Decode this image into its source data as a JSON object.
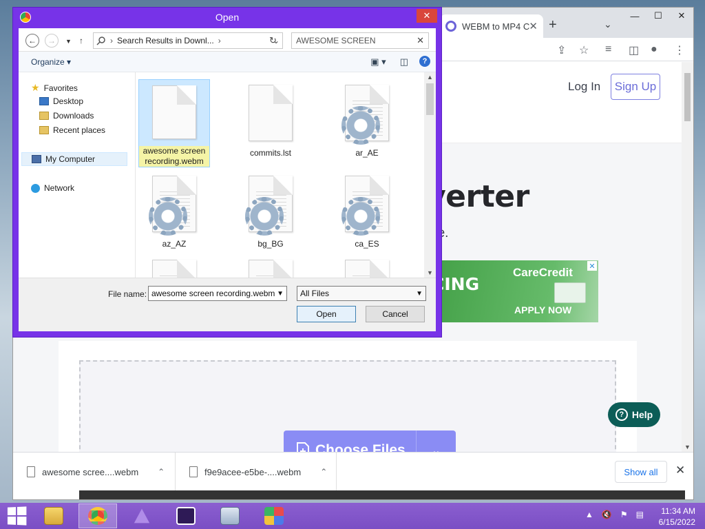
{
  "browser": {
    "tab_title": "WEBM to MP4 C",
    "tab_close": "✕",
    "new_tab": "+",
    "tabs_menu": "⌄",
    "window": {
      "minimize": "—",
      "maximize": "☐",
      "close": "✕"
    },
    "toolbar_icons": [
      "share-icon",
      "star-icon",
      "media-control-icon",
      "side-panel-icon",
      "profile-icon",
      "kebab-menu-icon"
    ]
  },
  "site": {
    "login": "Log In",
    "signup": "Sign Up",
    "hero_title": "verter",
    "hero_sub": "ee.",
    "ad": {
      "left_text": "CING",
      "brand": "CareCredit",
      "cta": "APPLY NOW",
      "close": "✕"
    },
    "choose_files": "Choose Files",
    "choose_chevron": "⌄",
    "help": "Help"
  },
  "downloads": {
    "items": [
      {
        "name": "awesome scree....webm"
      },
      {
        "name": "f9e9acee-e5be-....webm"
      }
    ],
    "show_all": "Show all",
    "close": "✕"
  },
  "dialog": {
    "title": "Open",
    "close": "✕",
    "address": "Search Results in Downl...",
    "search_value": "AWESOME SCREEN",
    "organize": "Organize",
    "nav_pane": {
      "favorites": "Favorites",
      "desktop": "Desktop",
      "downloads": "Downloads",
      "recent": "Recent places",
      "computer": "My Computer",
      "network": "Network"
    },
    "files": [
      {
        "name": "awesome screen recording.webm",
        "type": "blank",
        "selected": true
      },
      {
        "name": "commits.lst",
        "type": "blank",
        "selected": false
      },
      {
        "name": "ar_AE",
        "type": "config",
        "selected": false
      },
      {
        "name": "az_AZ",
        "type": "config",
        "selected": false
      },
      {
        "name": "bg_BG",
        "type": "config",
        "selected": false
      },
      {
        "name": "ca_ES",
        "type": "config",
        "selected": false
      },
      {
        "name": "",
        "type": "config",
        "selected": false
      },
      {
        "name": "",
        "type": "config",
        "selected": false
      },
      {
        "name": "",
        "type": "config",
        "selected": false
      }
    ],
    "file_name_label": "File name:",
    "file_name_value": "awesome screen recording.webm",
    "file_type": "All Files",
    "open_btn": "Open",
    "cancel_btn": "Cancel"
  },
  "taskbar": {
    "apps": [
      "file-explorer",
      "chrome",
      "app-purple",
      "app-cat",
      "app-monitor",
      "app-game"
    ],
    "time": "11:34 AM",
    "date": "6/15/2022"
  }
}
